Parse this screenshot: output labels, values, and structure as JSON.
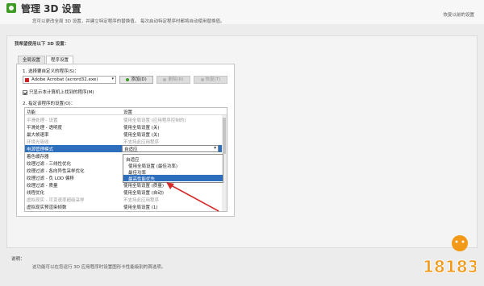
{
  "header": {
    "title": "管理 3D 设置",
    "restore_link": "恢复以前的设置",
    "description": "您可以更改全局 3D 设置，并建立特定程序的替换值。 每次启动特定程序时都将自动使用替换值。"
  },
  "main": {
    "section_title": "我希望使用以下 3D 设置：",
    "tabs": [
      {
        "label": "全局设置"
      },
      {
        "label": "程序设置"
      }
    ],
    "step1_label": "1. 选择要自定义的程序(S)：",
    "program_select": {
      "icon": "acrobat-icon",
      "value": "Adobe Acrobat (acrord32.exe)"
    },
    "buttons": {
      "add": "添加(D)",
      "remove": "删除(R)",
      "restore": "恢复(T)"
    },
    "checkbox_label": "只显示本计算机上找到的程序(M)",
    "step2_label": "2. 指定该程序的设置(O)：",
    "table": {
      "col_feature": "功能",
      "col_setting": "设置",
      "rows": [
        {
          "feature": "平滑处理 - 设置",
          "setting": "使用全局设置 (应用程序控制的)",
          "grey": true
        },
        {
          "feature": "平滑处理 - 透明度",
          "setting": "使用全局设置 (关)",
          "grey": false
        },
        {
          "feature": "最大帧速率",
          "setting": "使用全局设置 (关)",
          "grey": false
        },
        {
          "feature": "环境光吸收",
          "setting": "不支持此应用程序",
          "grey": true
        },
        {
          "feature": "电源管理模式",
          "setting": "自适应",
          "grey": false,
          "selected": true
        },
        {
          "feature": "着色缓存器",
          "setting": "使用全局设置 (最佳功率)",
          "grey": false
        },
        {
          "feature": "纹理过滤 - 三线性优化",
          "setting": "",
          "grey": false
        },
        {
          "feature": "纹理过滤 - 各向异性采样优化",
          "setting": "",
          "grey": false
        },
        {
          "feature": "纹理过滤 - 负 LOD 偏移",
          "setting": "",
          "grey": false
        },
        {
          "feature": "纹理过滤 - 质量",
          "setting": "使用全局设置 (质量)",
          "grey": false
        },
        {
          "feature": "线程优化",
          "setting": "使用全局设置 (自动)",
          "grey": false
        },
        {
          "feature": "虚拟现实 - 可变速率超级采样",
          "setting": "不支持此应用程序",
          "grey": true
        },
        {
          "feature": "虚拟现实预渲染帧数",
          "setting": "使用全局设置 (1)",
          "grey": false
        }
      ]
    },
    "dropdown": {
      "items": [
        {
          "label": "自适应",
          "style": "plain"
        },
        {
          "label": "使用全局设置 (最佳功率)",
          "style": "indent"
        },
        {
          "label": "最佳功率",
          "style": "indent"
        },
        {
          "label": "最高性能优先",
          "style": "highlight"
        }
      ]
    }
  },
  "footer": {
    "label": "说明：",
    "text": "这功能可以在您运行 3D 应用程序时设置图形卡性能级别的首选项。"
  },
  "watermark": {
    "text": "18183"
  },
  "colors": {
    "accent_green": "#3d9b24",
    "selection_blue": "#2e6fbd",
    "annotation_red": "#d62b2b"
  }
}
